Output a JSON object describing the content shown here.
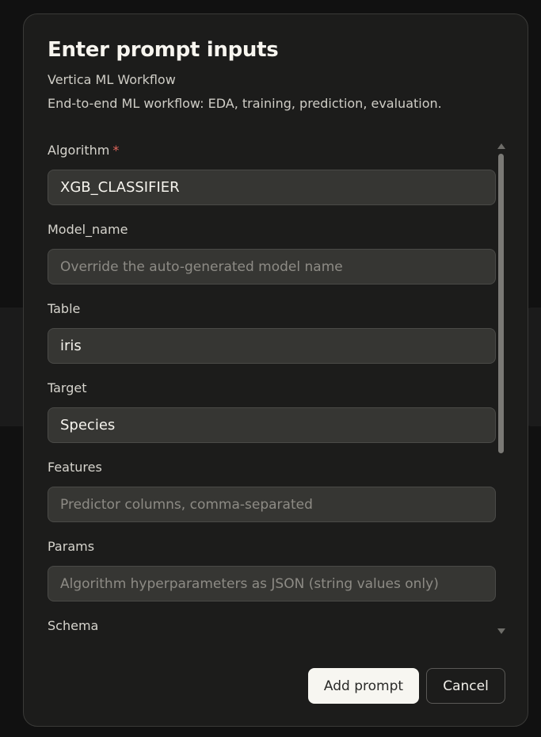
{
  "dialog": {
    "title": "Enter prompt inputs",
    "subtitle": "Vertica ML Workflow",
    "description": "End-to-end ML workflow: EDA, training, prediction, evaluation."
  },
  "fields": [
    {
      "label": "Algorithm",
      "required": "*",
      "value": "XGB_CLASSIFIER",
      "placeholder": ""
    },
    {
      "label": "Model_name",
      "value": "",
      "placeholder": "Override the auto-generated model name"
    },
    {
      "label": "Table",
      "value": "iris",
      "placeholder": ""
    },
    {
      "label": "Target",
      "value": "Species",
      "placeholder": ""
    },
    {
      "label": "Features",
      "value": "",
      "placeholder": "Predictor columns, comma-separated"
    },
    {
      "label": "Params",
      "value": "",
      "placeholder": "Algorithm hyperparameters as JSON (string values only)"
    },
    {
      "label": "Schema"
    }
  ],
  "actions": {
    "add_prompt_label": "Add prompt",
    "cancel_label": "Cancel"
  },
  "colors": {
    "modal_background": "#1c1c1b",
    "input_background": "#363633",
    "required_star": "#e0665c",
    "primary_button": "#f7f6f1"
  },
  "icons": {
    "scroll_up": "triangle-up-icon",
    "scroll_down": "triangle-down-icon"
  }
}
